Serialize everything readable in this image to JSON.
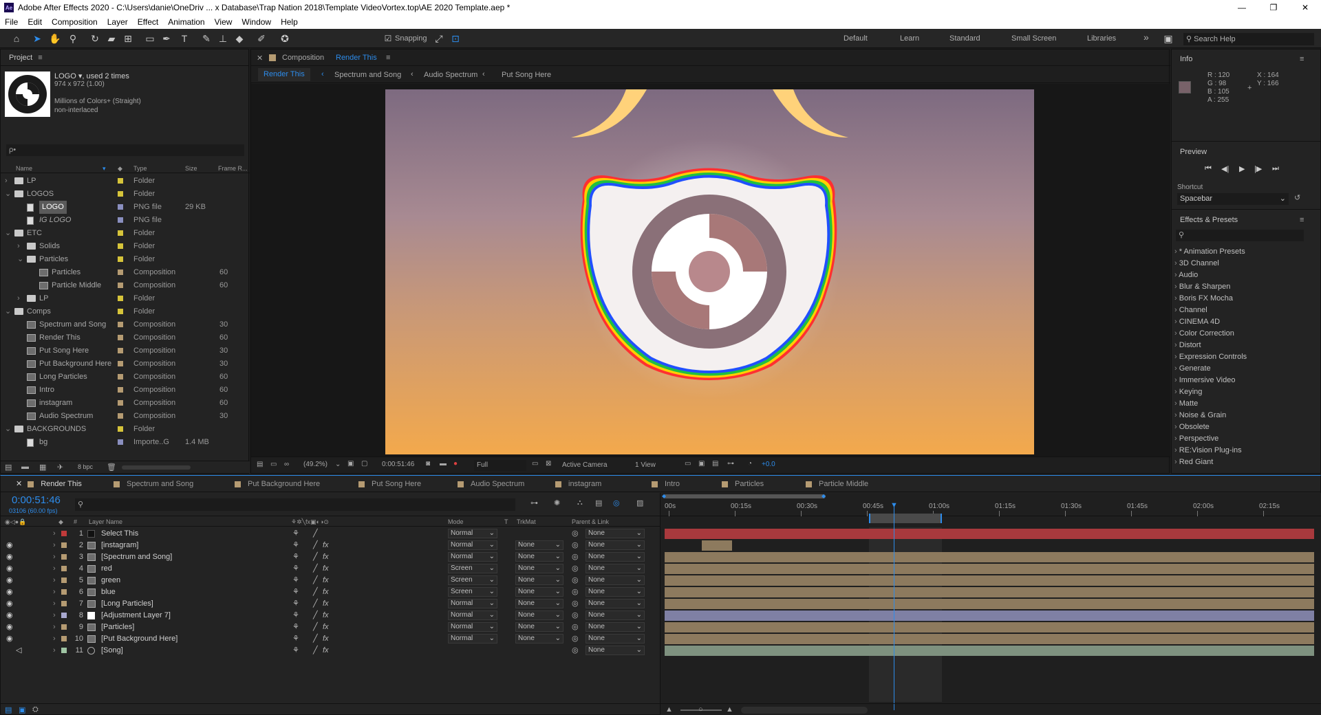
{
  "window": {
    "title": "Adobe After Effects 2020 - C:\\Users\\danie\\OneDriv ... x Database\\Trap Nation 2018\\Template VideoVortex.top\\AE 2020 Template.aep *",
    "app_icon": "Ae",
    "minimize": "—",
    "maximize": "❐",
    "close": "✕"
  },
  "menu": [
    "File",
    "Edit",
    "Composition",
    "Layer",
    "Effect",
    "Animation",
    "View",
    "Window",
    "Help"
  ],
  "toolbar": {
    "snapping": "Snapping",
    "workspaces": [
      "Default",
      "Learn",
      "Standard",
      "Small Screen",
      "Libraries"
    ],
    "more": "»",
    "search_help": "Search Help"
  },
  "project": {
    "title": "Project",
    "asset_name": "LOGO ▾, used 2 times",
    "asset_dims": "974 x 972 (1.00)",
    "asset_colors": "Millions of Colors+ (Straight)",
    "asset_interlace": "non-interlaced",
    "search_placeholder": "ρ•",
    "columns": [
      "Name",
      "Type",
      "Size",
      "Frame R..."
    ],
    "items": [
      {
        "indent": 0,
        "arrow": "›",
        "icon": "folder",
        "name": "LP",
        "label": "#d6c43a",
        "type": "Folder",
        "size": "",
        "fr": ""
      },
      {
        "indent": 0,
        "arrow": "⌄",
        "icon": "folder",
        "name": "LOGOS",
        "label": "#d6c43a",
        "type": "Folder",
        "size": "",
        "fr": ""
      },
      {
        "indent": 1,
        "arrow": "",
        "icon": "png",
        "name": "LOGO",
        "label": "#8a8fbf",
        "type": "PNG file",
        "size": "29 KB",
        "fr": "",
        "selected": true
      },
      {
        "indent": 1,
        "arrow": "",
        "icon": "png",
        "name": "IG LOGO",
        "label": "#8a8fbf",
        "type": "PNG file",
        "size": "",
        "fr": "",
        "italic": true
      },
      {
        "indent": 0,
        "arrow": "⌄",
        "icon": "folder",
        "name": "ETC",
        "label": "#d6c43a",
        "type": "Folder",
        "size": "",
        "fr": ""
      },
      {
        "indent": 1,
        "arrow": "›",
        "icon": "folder",
        "name": "Solids",
        "label": "#d6c43a",
        "type": "Folder",
        "size": "",
        "fr": ""
      },
      {
        "indent": 1,
        "arrow": "⌄",
        "icon": "folder",
        "name": "Particles",
        "label": "#d6c43a",
        "type": "Folder",
        "size": "",
        "fr": ""
      },
      {
        "indent": 2,
        "arrow": "",
        "icon": "comp",
        "name": "Particles",
        "label": "#b59b72",
        "type": "Composition",
        "size": "",
        "fr": "60"
      },
      {
        "indent": 2,
        "arrow": "",
        "icon": "comp",
        "name": "Particle Middle",
        "label": "#b59b72",
        "type": "Composition",
        "size": "",
        "fr": "60"
      },
      {
        "indent": 1,
        "arrow": "›",
        "icon": "folder",
        "name": "LP",
        "label": "#d6c43a",
        "type": "Folder",
        "size": "",
        "fr": ""
      },
      {
        "indent": 0,
        "arrow": "⌄",
        "icon": "folder",
        "name": "Comps",
        "label": "#d6c43a",
        "type": "Folder",
        "size": "",
        "fr": ""
      },
      {
        "indent": 1,
        "arrow": "",
        "icon": "comp",
        "name": "Spectrum and Song",
        "label": "#b59b72",
        "type": "Composition",
        "size": "",
        "fr": "30"
      },
      {
        "indent": 1,
        "arrow": "",
        "icon": "comp",
        "name": "Render This",
        "label": "#b59b72",
        "type": "Composition",
        "size": "",
        "fr": "60"
      },
      {
        "indent": 1,
        "arrow": "",
        "icon": "comp",
        "name": "Put Song Here",
        "label": "#b59b72",
        "type": "Composition",
        "size": "",
        "fr": "30"
      },
      {
        "indent": 1,
        "arrow": "",
        "icon": "comp",
        "name": "Put Background Here",
        "label": "#b59b72",
        "type": "Composition",
        "size": "",
        "fr": "30"
      },
      {
        "indent": 1,
        "arrow": "",
        "icon": "comp",
        "name": "Long Particles",
        "label": "#b59b72",
        "type": "Composition",
        "size": "",
        "fr": "60"
      },
      {
        "indent": 1,
        "arrow": "",
        "icon": "comp",
        "name": "Intro",
        "label": "#b59b72",
        "type": "Composition",
        "size": "",
        "fr": "60"
      },
      {
        "indent": 1,
        "arrow": "",
        "icon": "comp",
        "name": "instagram",
        "label": "#b59b72",
        "type": "Composition",
        "size": "",
        "fr": "60"
      },
      {
        "indent": 1,
        "arrow": "",
        "icon": "comp",
        "name": "Audio Spectrum",
        "label": "#b59b72",
        "type": "Composition",
        "size": "",
        "fr": "30"
      },
      {
        "indent": 0,
        "arrow": "⌄",
        "icon": "folder",
        "name": "BACKGROUNDS",
        "label": "#d6c43a",
        "type": "Folder",
        "size": "",
        "fr": ""
      },
      {
        "indent": 1,
        "arrow": "",
        "icon": "png",
        "name": "bg",
        "label": "#8a8fbf",
        "type": "Importe..G",
        "size": "1.4 MB",
        "fr": ""
      }
    ],
    "bpc": "8 bpc"
  },
  "composition": {
    "title_prefix": "Composition",
    "title_name": "Render This",
    "breadcrumbs": [
      "Render This",
      "Spectrum and Song",
      "Audio Spectrum",
      "Put Song Here"
    ],
    "zoom": "(49.2%)",
    "timecode": "0:00:51:46",
    "resolution": "Full",
    "camera": "Active Camera",
    "view": "1 View",
    "exposure": "+0.0"
  },
  "info": {
    "title": "Info",
    "r": "R : 120",
    "g": "G : 98",
    "b": "B : 105",
    "a": "A : 255",
    "x": "X : 164",
    "y": "Y : 166",
    "swatch": "#786269"
  },
  "preview": {
    "title": "Preview",
    "shortcut_label": "Shortcut",
    "shortcut_value": "Spacebar"
  },
  "effects": {
    "title": "Effects & Presets",
    "items": [
      "* Animation Presets",
      "3D Channel",
      "Audio",
      "Blur & Sharpen",
      "Boris FX Mocha",
      "Channel",
      "CINEMA 4D",
      "Color Correction",
      "Distort",
      "Expression Controls",
      "Generate",
      "Immersive Video",
      "Keying",
      "Matte",
      "Noise & Grain",
      "Obsolete",
      "Perspective",
      "RE:Vision Plug-ins",
      "Red Giant"
    ]
  },
  "timeline": {
    "tabs": [
      {
        "name": "Render This",
        "color": "#b59b72",
        "active": true
      },
      {
        "name": "Spectrum and Song",
        "color": "#b59b72"
      },
      {
        "name": "Put Background Here",
        "color": "#b59b72"
      },
      {
        "name": "Put Song Here",
        "color": "#b59b72"
      },
      {
        "name": "Audio Spectrum",
        "color": "#b59b72"
      },
      {
        "name": "instagram",
        "color": "#b59b72"
      },
      {
        "name": "Intro",
        "color": "#b59b72"
      },
      {
        "name": "Particles",
        "color": "#b59b72"
      },
      {
        "name": "Particle Middle",
        "color": "#b59b72"
      }
    ],
    "timecode": "0:00:51:46",
    "frames": "03106 (60.00 fps)",
    "col_layer_name": "Layer Name",
    "col_mode": "Mode",
    "col_t": "T",
    "col_trkmat": "TrkMat",
    "col_parent": "Parent & Link",
    "ruler": [
      "00s",
      "00:15s",
      "00:30s",
      "00:45s",
      "01:00s",
      "01:15s",
      "01:30s",
      "01:45s",
      "02:00s",
      "02:15s"
    ],
    "layers": [
      {
        "num": "1",
        "name": "Select This",
        "label": "#c03a3a",
        "icon": "solid",
        "mode": "Normal",
        "trkmat": "",
        "parent": "None",
        "eye": false,
        "bar": "#a8393d"
      },
      {
        "num": "2",
        "name": "[instagram]",
        "label": "#b59b72",
        "icon": "comp",
        "mode": "Normal",
        "trkmat": "None",
        "parent": "None",
        "eye": true,
        "bar": "#8d7a5e"
      },
      {
        "num": "3",
        "name": "[Spectrum and Song]",
        "label": "#b59b72",
        "icon": "comp",
        "mode": "Normal",
        "trkmat": "None",
        "parent": "None",
        "eye": true,
        "bar": "#8d7a5e"
      },
      {
        "num": "4",
        "name": "red",
        "label": "#b59b72",
        "icon": "comp",
        "mode": "Screen",
        "trkmat": "None",
        "parent": "None",
        "eye": true,
        "bar": "#8d7a5e"
      },
      {
        "num": "5",
        "name": "green",
        "label": "#b59b72",
        "icon": "comp",
        "mode": "Screen",
        "trkmat": "None",
        "parent": "None",
        "eye": true,
        "bar": "#8d7a5e"
      },
      {
        "num": "6",
        "name": "blue",
        "label": "#b59b72",
        "icon": "comp",
        "mode": "Screen",
        "trkmat": "None",
        "parent": "None",
        "eye": true,
        "bar": "#8d7a5e"
      },
      {
        "num": "7",
        "name": "[Long Particles]",
        "label": "#b59b72",
        "icon": "comp",
        "mode": "Normal",
        "trkmat": "None",
        "parent": "None",
        "eye": true,
        "bar": "#8d7a5e"
      },
      {
        "num": "8",
        "name": "[Adjustment Layer 7]",
        "label": "#a9a9d0",
        "icon": "adjust",
        "mode": "Normal",
        "trkmat": "None",
        "parent": "None",
        "eye": true,
        "bar": "#7f80a4"
      },
      {
        "num": "9",
        "name": "[Particles]",
        "label": "#b59b72",
        "icon": "comp",
        "mode": "Normal",
        "trkmat": "None",
        "parent": "None",
        "eye": true,
        "bar": "#8d7a5e"
      },
      {
        "num": "10",
        "name": "[Put Background Here]",
        "label": "#b59b72",
        "icon": "comp",
        "mode": "Normal",
        "trkmat": "None",
        "parent": "None",
        "eye": true,
        "bar": "#8d7a5e"
      },
      {
        "num": "11",
        "name": "[Song]",
        "label": "#9fc5a3",
        "icon": "audio",
        "mode": "",
        "trkmat": "",
        "parent": "None",
        "eye": false,
        "bar": "#7e917f"
      }
    ]
  }
}
